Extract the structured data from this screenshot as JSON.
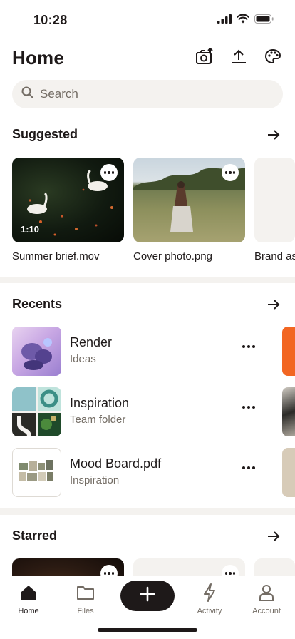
{
  "status_bar": {
    "time": "10:28"
  },
  "header": {
    "title": "Home",
    "actions": [
      {
        "icon": "camera-upload-icon"
      },
      {
        "icon": "upload-icon"
      },
      {
        "icon": "palette-icon"
      }
    ]
  },
  "search": {
    "placeholder": "Search",
    "icon": "search-icon"
  },
  "suggested": {
    "title": "Suggested",
    "cards": [
      {
        "name": "Summer brief.mov",
        "duration": "1:10"
      },
      {
        "name": "Cover photo.png"
      },
      {
        "name": "Brand assets"
      }
    ]
  },
  "recents": {
    "title": "Recents",
    "items": [
      {
        "name": "Render",
        "subtitle": "Ideas"
      },
      {
        "name": "Inspiration",
        "subtitle": "Team folder"
      },
      {
        "name": "Mood Board.pdf",
        "subtitle": "Inspiration"
      }
    ]
  },
  "starred": {
    "title": "Starred"
  },
  "bottom_nav": {
    "items": [
      {
        "label": "Home",
        "icon": "home-icon",
        "active": true
      },
      {
        "label": "Files",
        "icon": "folder-icon"
      },
      {
        "label": "Activity",
        "icon": "lightning-icon"
      },
      {
        "label": "Account",
        "icon": "person-icon"
      }
    ],
    "create_icon": "plus-icon"
  },
  "colors": {
    "text": "#1e1919",
    "muted": "#736c64",
    "surface": "#f4f2ef",
    "accent_orange": "#f26622"
  }
}
